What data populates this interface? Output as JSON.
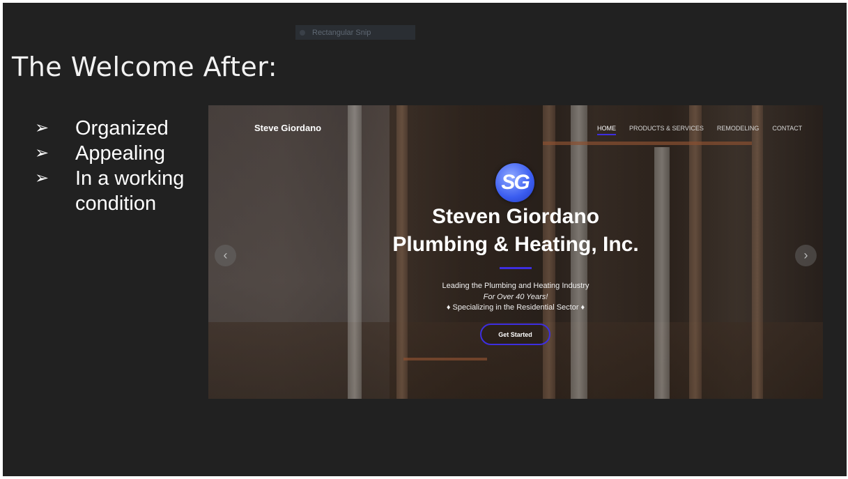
{
  "toolbar": {
    "snip_label": "Rectangular Snip"
  },
  "slide": {
    "title": "The Welcome After:",
    "bullets": [
      {
        "marker": "➢",
        "text": "Organized"
      },
      {
        "marker": "➢",
        "text": "Appealing"
      },
      {
        "marker": "➢",
        "text": "In a working condition"
      }
    ]
  },
  "website": {
    "brand": "Steve Giordano",
    "nav": [
      {
        "label": "HOME",
        "active": true
      },
      {
        "label": "PRODUCTS & SERVICES",
        "active": false
      },
      {
        "label": "REMODELING",
        "active": false
      },
      {
        "label": "CONTACT",
        "active": false
      }
    ],
    "logo_text": "SG",
    "hero_title_line1": "Steven Giordano",
    "hero_title_line2": "Plumbing & Heating, Inc.",
    "tagline_line1": "Leading the Plumbing and Heating Industry",
    "tagline_line2": "For Over 40 Years!",
    "tagline_line3": "♦ Specializing in the Residential Sector ♦",
    "cta_label": "Get Started",
    "prev_arrow": "‹",
    "next_arrow": "›",
    "accent_color": "#3d2ee0"
  }
}
